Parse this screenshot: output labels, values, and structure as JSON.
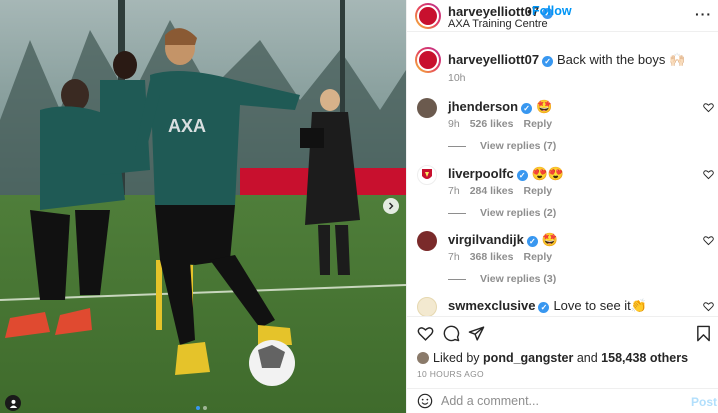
{
  "post": {
    "username": "harveyelliott07",
    "follow_label": "Follow",
    "location": "AXA Training Centre",
    "caption_text": "Back with the boys 🙌🏻",
    "caption_time": "10h",
    "more_icon": "more-horizontal-icon"
  },
  "comments": [
    {
      "user": "jhenderson",
      "text": "🤩",
      "time": "9h",
      "likes": "526 likes",
      "reply": "Reply",
      "replies": "View replies (7)"
    },
    {
      "user": "liverpoolfc",
      "text": "😍😍",
      "time": "7h",
      "likes": "284 likes",
      "reply": "Reply",
      "replies": "View replies (2)"
    },
    {
      "user": "virgilvandijk",
      "text": "🤩",
      "time": "7h",
      "likes": "368 likes",
      "reply": "Reply",
      "replies": "View replies (3)"
    },
    {
      "user": "swmexclusive",
      "text": "Love to see it👏",
      "time": "",
      "likes": "",
      "reply": "",
      "replies": ""
    }
  ],
  "actions": {
    "liked_prefix": "Liked by",
    "liked_user": "pond_gangster",
    "liked_and": "and",
    "liked_count": "158,438 others",
    "time_ago": "10 HOURS AGO",
    "comment_placeholder": "Add a comment...",
    "post_label": "Post"
  },
  "photo": {
    "shirt_sponsor": "AXA",
    "carousel_count": 2,
    "carousel_active": 1
  },
  "colors": {
    "link": "#0095f6",
    "verified": "#3897f0",
    "muted": "#8e8e8e",
    "post_disabled": "#b2dffc"
  }
}
